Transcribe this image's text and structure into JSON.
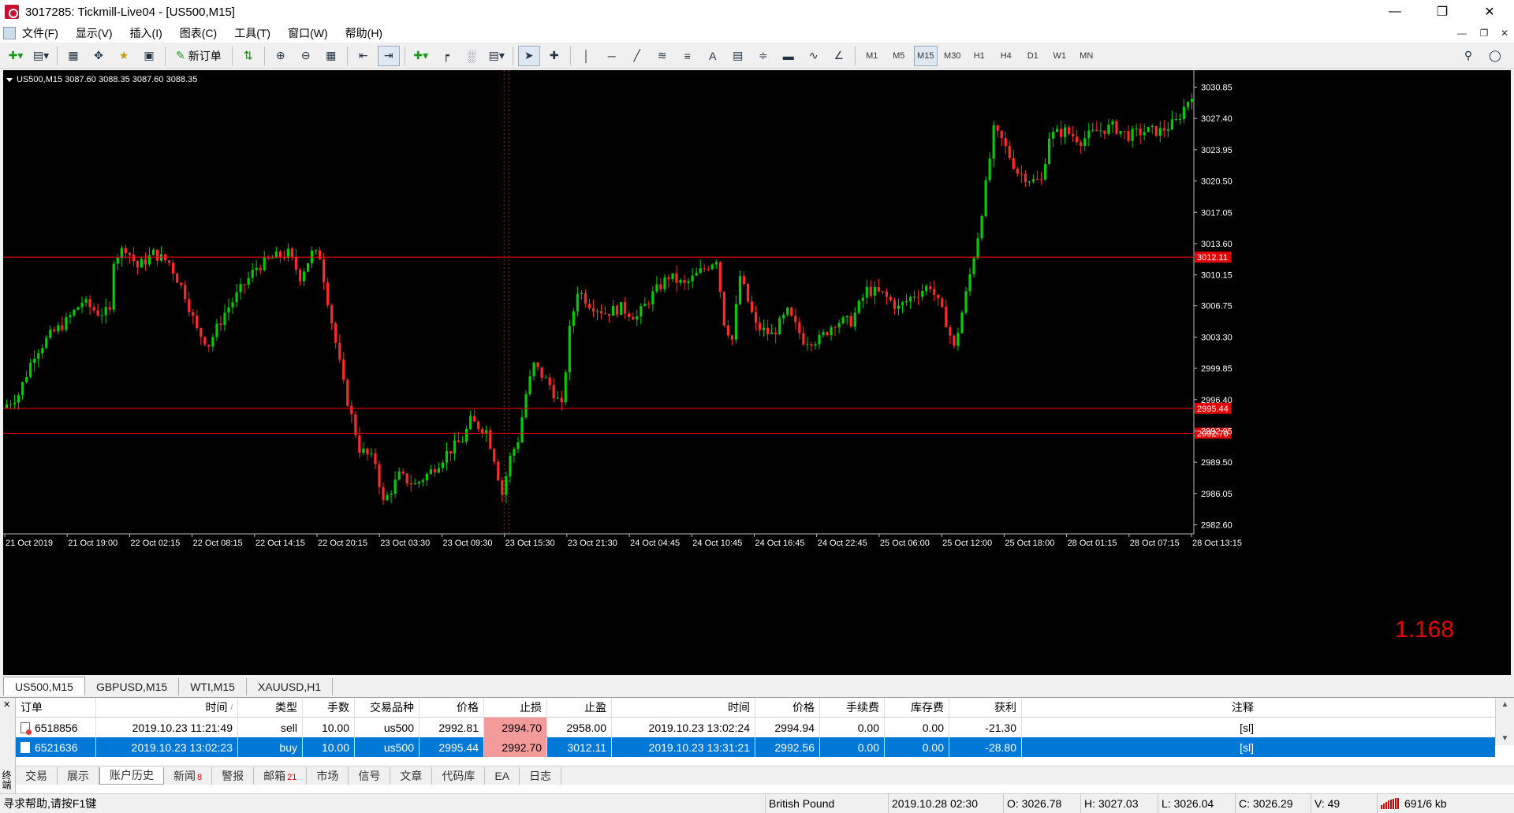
{
  "window": {
    "title": "3017285: Tickmill-Live04 - [US500,M15]"
  },
  "menu": [
    "文件(F)",
    "显示(V)",
    "插入(I)",
    "图表(C)",
    "工具(T)",
    "窗口(W)",
    "帮助(H)"
  ],
  "toolbar": {
    "new_order_label": "新订单",
    "timeframes": [
      "M1",
      "M5",
      "M15",
      "M30",
      "H1",
      "H4",
      "D1",
      "W1",
      "MN"
    ],
    "active_timeframe": "M15"
  },
  "chart": {
    "info": "US500,M15  3087.60 3088.35 3087.60 3088.35",
    "overlay_value": "1.168",
    "bg_color": "#000000",
    "bull_color": "#00cc00",
    "bear_color": "#ff2a2a"
  },
  "chart_data": {
    "type": "candlestick",
    "symbol": "US500",
    "timeframe": "M15",
    "y_ticks": [
      "3030.85",
      "3027.40",
      "3023.95",
      "3020.50",
      "3017.05",
      "3013.60",
      "3010.15",
      "3006.75",
      "3003.30",
      "2999.85",
      "2996.40",
      "2992.95",
      "2989.50",
      "2986.05",
      "2982.60"
    ],
    "ylim": [
      2981.6,
      3032.2
    ],
    "x_ticks": [
      "21 Oct 2019",
      "21 Oct 19:00",
      "22 Oct 02:15",
      "22 Oct 08:15",
      "22 Oct 14:15",
      "22 Oct 20:15",
      "23 Oct 03:30",
      "23 Oct 09:30",
      "23 Oct 15:30",
      "23 Oct 21:30",
      "24 Oct 04:45",
      "24 Oct 10:45",
      "24 Oct 16:45",
      "24 Oct 22:45",
      "25 Oct 06:00",
      "25 Oct 12:00",
      "25 Oct 18:00",
      "28 Oct 01:15",
      "28 Oct 07:15",
      "28 Oct 13:15"
    ],
    "price_lines": [
      {
        "label": "3012.11",
        "value": 3012.11,
        "color": "#ff0000"
      },
      {
        "label": "2995.44",
        "value": 2995.44,
        "color": "#ff0000"
      },
      {
        "label": "2992.70",
        "value": 2992.7,
        "color": "#ff0000"
      }
    ],
    "price_path": [
      [
        0,
        2995.5
      ],
      [
        4,
        2997
      ],
      [
        8,
        3001.5
      ],
      [
        12,
        3003.5
      ],
      [
        16,
        3005
      ],
      [
        20,
        3007.2
      ],
      [
        24,
        3006
      ],
      [
        27,
        3006
      ],
      [
        28,
        3012
      ],
      [
        31,
        3013.2
      ],
      [
        34,
        3011
      ],
      [
        38,
        3012.5
      ],
      [
        42,
        3011.5
      ],
      [
        46,
        3008
      ],
      [
        49,
        3004
      ],
      [
        52,
        3002.5
      ],
      [
        56,
        3006
      ],
      [
        60,
        3008.5
      ],
      [
        64,
        3011
      ],
      [
        68,
        3012
      ],
      [
        72,
        3012.5
      ],
      [
        75,
        3010
      ],
      [
        78,
        3012.5
      ],
      [
        80,
        3012.2
      ],
      [
        83,
        3005
      ],
      [
        86,
        2998
      ],
      [
        90,
        2991
      ],
      [
        94,
        2989.5
      ],
      [
        96,
        2985
      ],
      [
        100,
        2988
      ],
      [
        104,
        2987
      ],
      [
        108,
        2988.5
      ],
      [
        112,
        2990.5
      ],
      [
        116,
        2992
      ],
      [
        118,
        2994
      ],
      [
        122,
        2993
      ],
      [
        124,
        2990
      ],
      [
        126,
        2986
      ],
      [
        128,
        2990
      ],
      [
        130,
        2992
      ],
      [
        132,
        2997
      ],
      [
        134,
        3000.2
      ],
      [
        138,
        2998
      ],
      [
        141,
        2995.5
      ],
      [
        143,
        3004
      ],
      [
        145,
        3008.5
      ],
      [
        148,
        3007
      ],
      [
        152,
        3006
      ],
      [
        156,
        3006.5
      ],
      [
        160,
        3005.5
      ],
      [
        164,
        3008
      ],
      [
        168,
        3010
      ],
      [
        172,
        3009
      ],
      [
        176,
        3010.5
      ],
      [
        180,
        3012
      ],
      [
        182,
        3005
      ],
      [
        184,
        3003
      ],
      [
        186,
        3010
      ],
      [
        190,
        3004.5
      ],
      [
        194,
        3003.5
      ],
      [
        198,
        3006
      ],
      [
        202,
        3003
      ],
      [
        206,
        3003
      ],
      [
        210,
        3005
      ],
      [
        214,
        3005
      ],
      [
        218,
        3008.5
      ],
      [
        222,
        3008
      ],
      [
        226,
        3006.5
      ],
      [
        230,
        3008
      ],
      [
        234,
        3009
      ],
      [
        238,
        3005
      ],
      [
        240,
        3002
      ],
      [
        243,
        3008
      ],
      [
        246,
        3014.5
      ],
      [
        248,
        3020
      ],
      [
        250,
        3026
      ],
      [
        252,
        3025
      ],
      [
        256,
        3021.5
      ],
      [
        260,
        3020.5
      ],
      [
        262,
        3020.5
      ],
      [
        264,
        3025.5
      ],
      [
        268,
        3026
      ],
      [
        272,
        3025
      ],
      [
        276,
        3026
      ],
      [
        280,
        3026.5
      ],
      [
        284,
        3025.5
      ],
      [
        288,
        3026
      ],
      [
        292,
        3026
      ],
      [
        296,
        3027
      ],
      [
        300,
        3030.2
      ]
    ],
    "n_candles": 300
  },
  "chart_tabs": [
    "US500,M15",
    "GBPUSD,M15",
    "WTI,M15",
    "XAUUSD,H1"
  ],
  "terminal": {
    "side_label": "终端",
    "columns": [
      "订单",
      "时间",
      "类型",
      "手数",
      "交易品种",
      "价格",
      "止损",
      "止盈",
      "时间",
      "价格",
      "手续费",
      "库存费",
      "获利",
      "注释"
    ],
    "rows": [
      {
        "order": "6518856",
        "open_time": "2019.10.23 11:21:49",
        "type": "sell",
        "lots": "10.00",
        "symbol": "us500",
        "price": "2992.81",
        "sl": "2994.70",
        "tp": "2958.00",
        "close_time": "2019.10.23 13:02:24",
        "close_price": "2994.94",
        "commission": "0.00",
        "swap": "0.00",
        "profit": "-21.30",
        "comment": "[sl]"
      },
      {
        "order": "6521636",
        "open_time": "2019.10.23 13:02:23",
        "type": "buy",
        "lots": "10.00",
        "symbol": "us500",
        "price": "2995.44",
        "sl": "2992.70",
        "tp": "3012.11",
        "close_time": "2019.10.23 13:31:21",
        "close_price": "2992.56",
        "commission": "0.00",
        "swap": "0.00",
        "profit": "-28.80",
        "comment": "[sl]"
      }
    ],
    "tabs": [
      {
        "label": "交易"
      },
      {
        "label": "展示"
      },
      {
        "label": "账户历史",
        "active": true
      },
      {
        "label": "新闻",
        "badge": "8"
      },
      {
        "label": "警报"
      },
      {
        "label": "邮箱",
        "badge": "21"
      },
      {
        "label": "市场"
      },
      {
        "label": "信号"
      },
      {
        "label": "文章"
      },
      {
        "label": "代码库"
      },
      {
        "label": "EA"
      },
      {
        "label": "日志"
      }
    ]
  },
  "status": {
    "help": "寻求帮助,请按F1键",
    "profile": "British Pound",
    "datetime": "2019.10.28 02:30",
    "open": "O: 3026.78",
    "high": "H: 3027.03",
    "low": "L: 3026.04",
    "close": "C: 3026.29",
    "volume": "V: 49",
    "traffic": "691/6 kb"
  }
}
